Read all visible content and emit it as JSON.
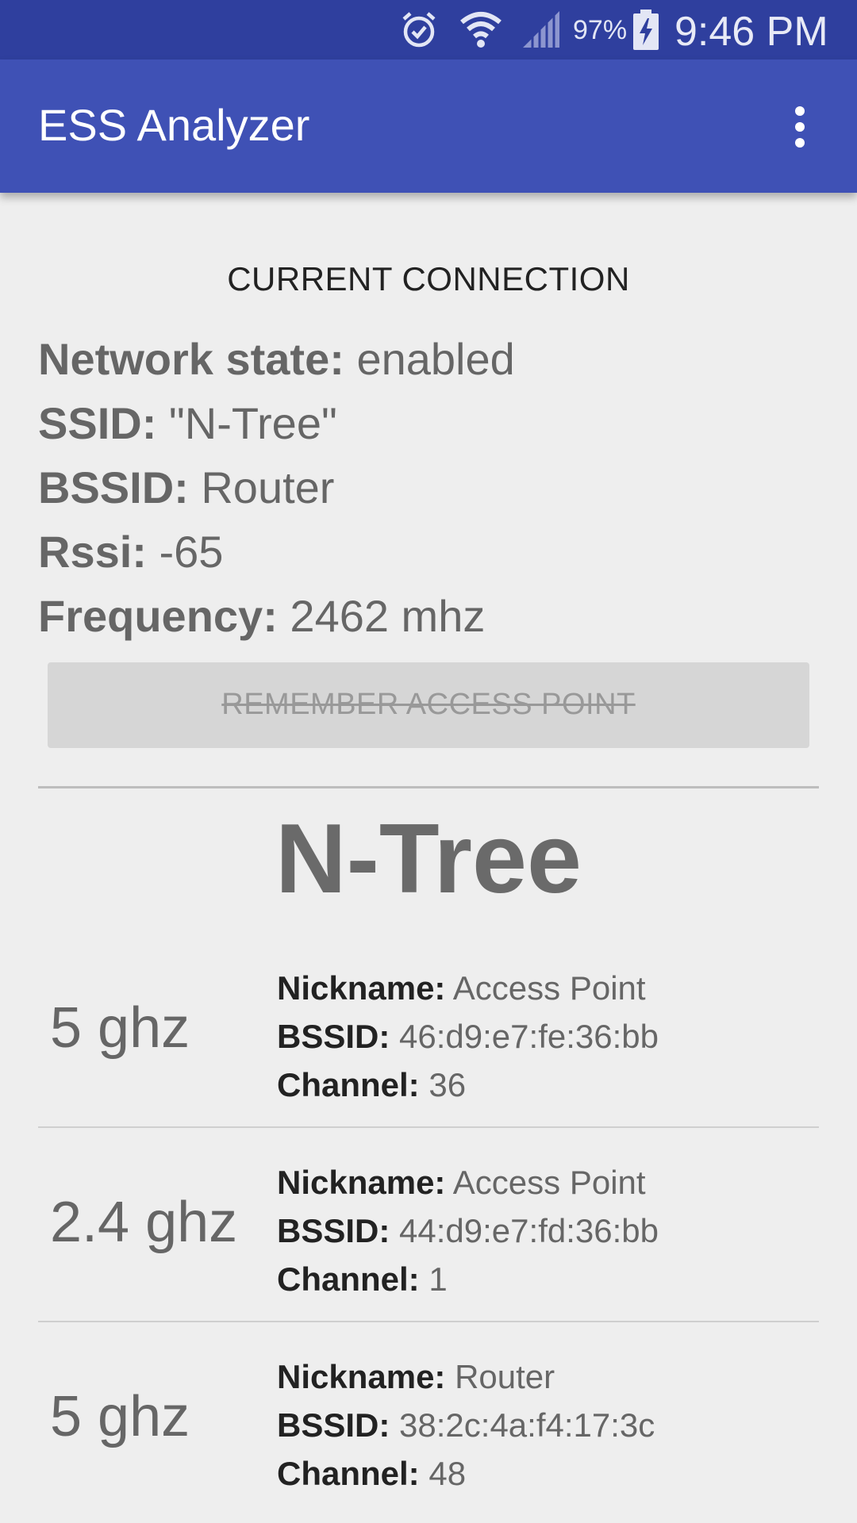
{
  "status_bar": {
    "icons": [
      "alarm-icon",
      "wifi-icon",
      "cell-signal-icon",
      "battery-charging-icon"
    ],
    "battery": "97%",
    "time": "9:46 PM"
  },
  "app_bar": {
    "title": "ESS Analyzer",
    "menu_icon": "overflow-menu-icon"
  },
  "current_connection": {
    "heading": "CURRENT CONNECTION",
    "network_state_label": "Network state:",
    "network_state_value": "enabled",
    "ssid_label": "SSID:",
    "ssid_value": "\"N-Tree\"",
    "bssid_label": "BSSID:",
    "bssid_value": "Router",
    "rssi_label": "Rssi:",
    "rssi_value": "-65",
    "frequency_label": "Frequency:",
    "frequency_value": "2462 mhz",
    "remember_button": "REMEMBER ACCESS POINT"
  },
  "network": {
    "name": "N-Tree",
    "access_points": [
      {
        "band": "5 ghz",
        "nickname_label": "Nickname:",
        "nickname": "Access Point",
        "bssid_label": "BSSID:",
        "bssid": "46:d9:e7:fe:36:bb",
        "channel_label": "Channel:",
        "channel": "36"
      },
      {
        "band": "2.4 ghz",
        "nickname_label": "Nickname:",
        "nickname": "Access Point",
        "bssid_label": "BSSID:",
        "bssid": "44:d9:e7:fd:36:bb",
        "channel_label": "Channel:",
        "channel": "1"
      },
      {
        "band": "5 ghz",
        "nickname_label": "Nickname:",
        "nickname": "Router",
        "bssid_label": "BSSID:",
        "bssid": "38:2c:4a:f4:17:3c",
        "channel_label": "Channel:",
        "channel": "48"
      }
    ]
  },
  "colors": {
    "status_bar": "#2f3f9e",
    "app_bar": "#3f51b5",
    "background": "#eeeeee"
  }
}
